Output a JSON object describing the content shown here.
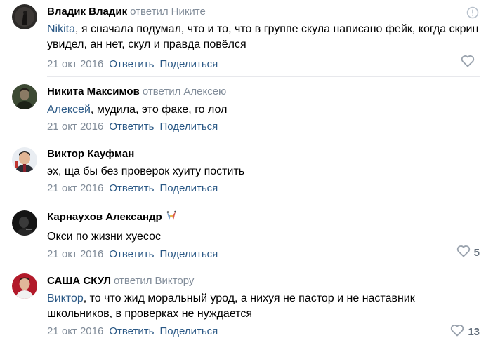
{
  "comments": [
    {
      "author": "Владик Владик",
      "reply_word": "ответил",
      "reply_to": "Никите",
      "mention": "Nikita",
      "text": ", я сначала подумал, что и то, что в группе скула написано фейк, когда скрин увидел, ан нет, скул и правда повёлся",
      "date": "21 окт 2016",
      "reply_label": "Ответить",
      "share_label": "Поделиться",
      "likes": ""
    },
    {
      "author": "Никита Максимов",
      "reply_word": "ответил",
      "reply_to": "Алексею",
      "mention": "Алексей",
      "text": ", мудила, это факе, го лол",
      "date": "21 окт 2016",
      "reply_label": "Ответить",
      "share_label": "Поделиться",
      "likes": ""
    },
    {
      "author": "Виктор Кауфман",
      "text": "эх, ща бы без проверок хуиту постить",
      "date": "21 окт 2016",
      "reply_label": "Ответить",
      "share_label": "Поделиться",
      "likes": ""
    },
    {
      "author": "Карнаухов Александр",
      "badge_icon": "gift-badge-icon",
      "text": "Окси по жизни хуесос",
      "date": "21 окт 2016",
      "reply_label": "Ответить",
      "share_label": "Поделиться",
      "likes": "5"
    },
    {
      "author": "САША СКУЛ",
      "reply_word": "ответил",
      "reply_to": "Виктору",
      "mention": "Виктор",
      "text": ", то что жид моральный урод, а нихуя не пастор и не наставник школьников, в проверках не нуждается",
      "date": "21 окт 2016",
      "reply_label": "Ответить",
      "share_label": "Поделиться",
      "likes": "13"
    }
  ],
  "colors": {
    "link": "#2a5885",
    "muted": "#818c99",
    "icon": "#99a2ad",
    "divider": "#e7e8ec"
  }
}
